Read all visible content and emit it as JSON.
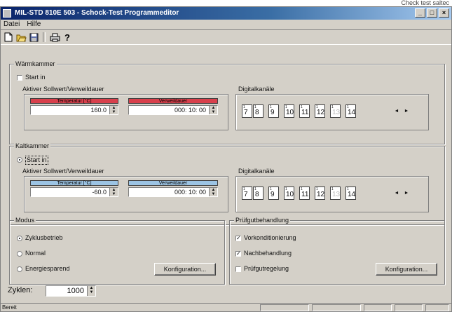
{
  "top_caption": "Check test saltec",
  "window": {
    "title": "MIL-STD 810E 503 - Schock-Test Programmeditor",
    "min_label": "_",
    "max_label": "□",
    "close_label": "×"
  },
  "menu": [
    "Datei",
    "Hilfe"
  ],
  "toolbar": {
    "icons": [
      "new-doc-icon",
      "open-folder-icon",
      "save-icon",
      "print-icon",
      "help-icon"
    ]
  },
  "chambers": [
    {
      "title": "Wärmkammer",
      "start_label": "Start in",
      "start_checked": false,
      "active_label": "Aktiver Sollwert/Verweildauer",
      "temp_header": "Temperatur [°C]",
      "temp_value": "160.0",
      "time_header": "Verweildauer",
      "time_value": "000: 10: 00",
      "header_color": "#d8404c",
      "digital_label": "Digitalkanäle",
      "channels": [
        "7",
        "8",
        "9",
        "10",
        "11",
        "12",
        "13",
        "14"
      ],
      "channels_active": [
        true,
        true,
        true,
        true,
        true,
        true,
        false,
        true
      ]
    },
    {
      "title": "Kaltkammer",
      "start_label": "Start in",
      "start_checked": true,
      "active_label": "Aktiver Sollwert/Verweildauer",
      "temp_header": "Temperatur [°C]",
      "temp_value": "-60.0",
      "time_header": "Verweildauer",
      "time_value": "000: 10: 00",
      "header_color": "#9cc4e4",
      "digital_label": "Digitalkanäle",
      "channels": [
        "7",
        "8",
        "9",
        "10",
        "11",
        "12",
        "13",
        "14"
      ],
      "channels_active": [
        true,
        true,
        true,
        true,
        true,
        true,
        false,
        true
      ]
    }
  ],
  "mode": {
    "title": "Modus",
    "options": [
      "Zyklusbetrieb",
      "Normal",
      "Energiesparend"
    ],
    "selected": 0,
    "config_button": "Konfiguration..."
  },
  "treatment": {
    "title": "Prüfgutbehandlung",
    "options": [
      {
        "label": "Vorkonditionierung",
        "checked": true
      },
      {
        "label": "Nachbehandlung",
        "checked": true
      },
      {
        "label": "Prüfgutregelung",
        "checked": false
      }
    ],
    "config_button": "Konfiguration..."
  },
  "cycles": {
    "label": "Zyklen:",
    "value": "1000"
  },
  "status_bar": {
    "text": "Bereit"
  }
}
